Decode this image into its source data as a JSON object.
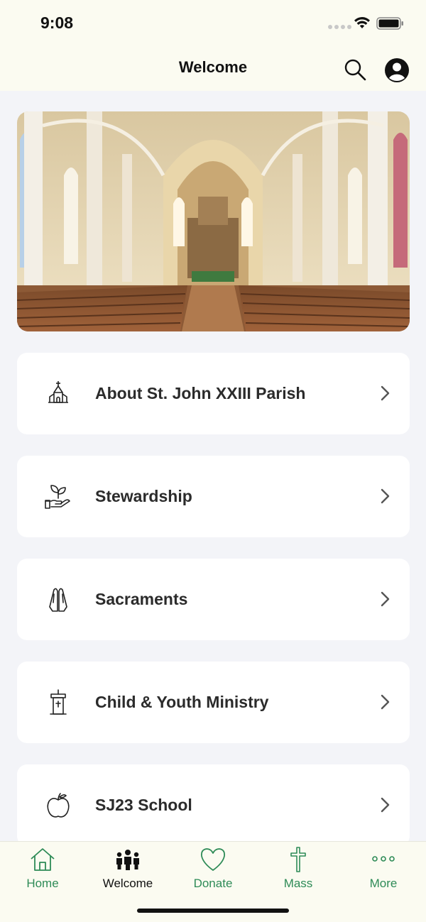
{
  "status_bar": {
    "time": "9:08"
  },
  "header": {
    "title": "Welcome"
  },
  "menu": [
    {
      "label": "About St. John XXIII Parish",
      "icon": "church-icon"
    },
    {
      "label": "Stewardship",
      "icon": "hand-plant-icon"
    },
    {
      "label": "Sacraments",
      "icon": "praying-hands-icon"
    },
    {
      "label": "Child & Youth Ministry",
      "icon": "pulpit-icon"
    },
    {
      "label": "SJ23 School",
      "icon": "apple-icon"
    }
  ],
  "tabs": [
    {
      "label": "Home",
      "icon": "home-icon",
      "active": false
    },
    {
      "label": "Welcome",
      "icon": "people-icon",
      "active": true
    },
    {
      "label": "Donate",
      "icon": "heart-icon",
      "active": false
    },
    {
      "label": "Mass",
      "icon": "cross-icon",
      "active": false
    },
    {
      "label": "More",
      "icon": "more-dots-icon",
      "active": false
    }
  ],
  "colors": {
    "accent": "#2e8b57",
    "header_bg": "#fbfbf1",
    "page_bg": "#f3f4f8"
  }
}
